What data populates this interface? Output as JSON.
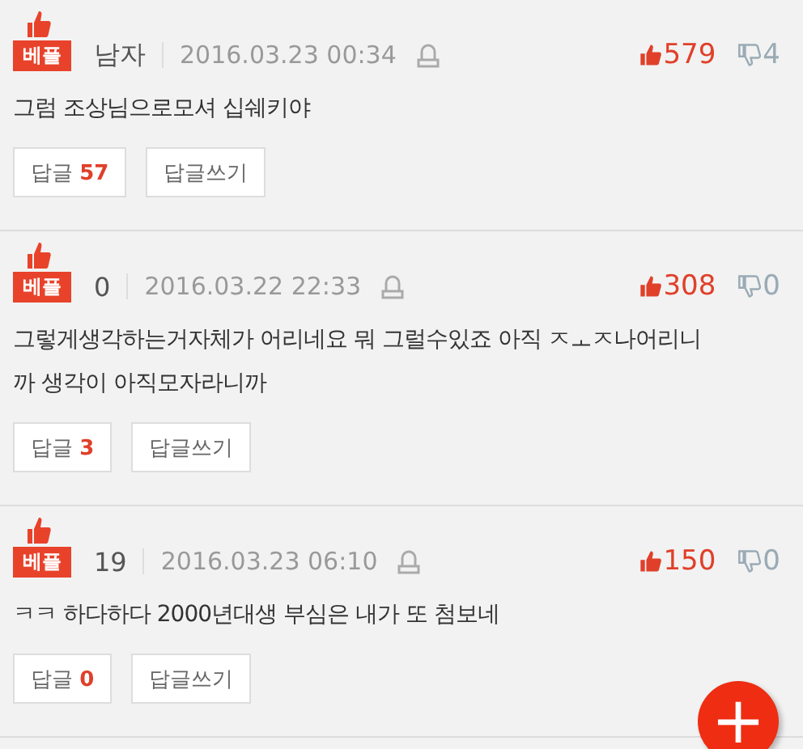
{
  "comments": [
    {
      "badge": "베플",
      "author": "남자",
      "date": "2016.03.23 00:34",
      "likes": "579",
      "dislikes": "4",
      "text": "그럼 조상님으로모셔 십쉐키야",
      "reply_label": "답글",
      "reply_count": "57",
      "write_label": "답글쓰기"
    },
    {
      "badge": "베플",
      "author": "0",
      "date": "2016.03.22 22:33",
      "likes": "308",
      "dislikes": "0",
      "text": "그렇게생각하는거자체가 어리네요 뭐 그럴수있죠 아직 ㅈㅗㅈ나어리니까 생각이 아직모자라니까",
      "reply_label": "답글",
      "reply_count": "3",
      "write_label": "답글쓰기"
    },
    {
      "badge": "베플",
      "author": "19",
      "date": "2016.03.23 06:10",
      "likes": "150",
      "dislikes": "0",
      "text": "ㅋㅋ 하다하다 2000년대생 부심은 내가 또 첨보네",
      "reply_label": "답글",
      "reply_count": "0",
      "write_label": "답글쓰기"
    }
  ],
  "fab": {
    "label": "+"
  }
}
